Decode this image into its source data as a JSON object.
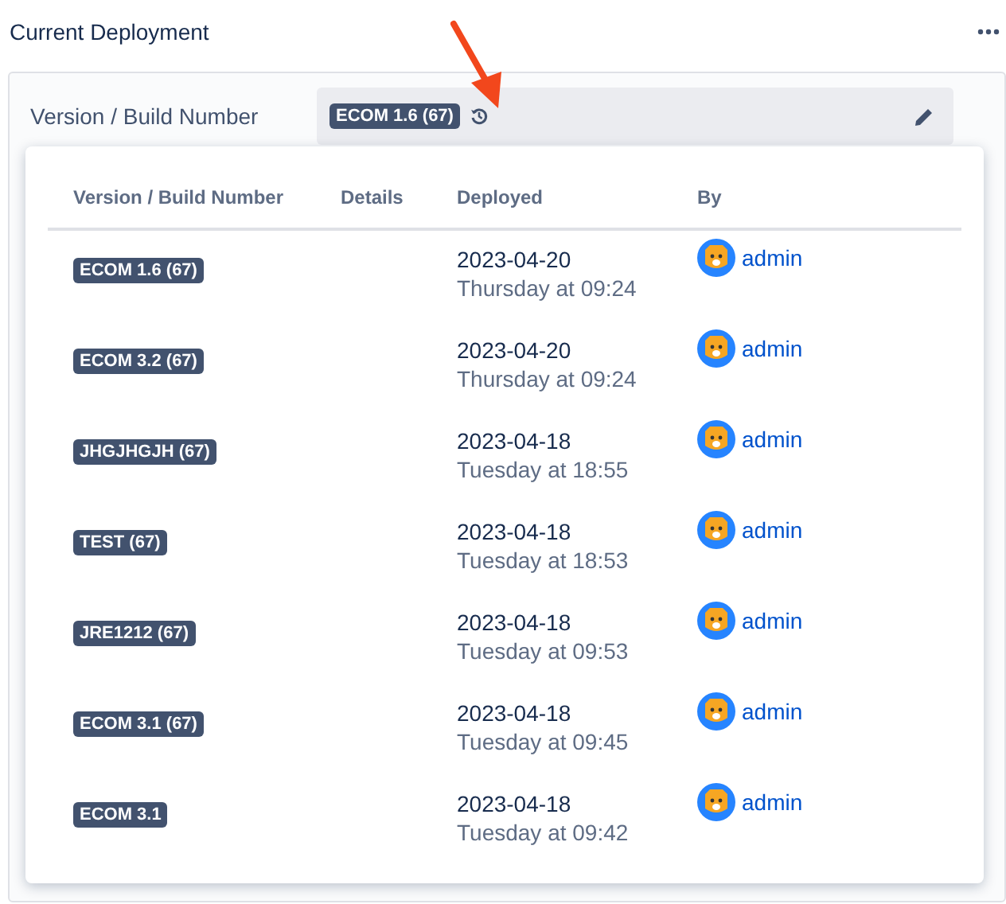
{
  "header": {
    "title": "Current Deployment"
  },
  "field": {
    "label": "Version / Build Number",
    "value": "ECOM 1.6 (67)"
  },
  "history": {
    "columns": [
      "Version / Build Number",
      "Details",
      "Deployed",
      "By"
    ],
    "rows": [
      {
        "version": "ECOM 1.6 (67)",
        "date": "2023-04-20",
        "time": "Thursday at 09:24",
        "by": "admin"
      },
      {
        "version": "ECOM 3.2 (67)",
        "date": "2023-04-20",
        "time": "Thursday at 09:24",
        "by": "admin"
      },
      {
        "version": "JHGJHGJH (67)",
        "date": "2023-04-18",
        "time": "Tuesday at 18:55",
        "by": "admin"
      },
      {
        "version": "TEST (67)",
        "date": "2023-04-18",
        "time": "Tuesday at 18:53",
        "by": "admin"
      },
      {
        "version": "JRE1212 (67)",
        "date": "2023-04-18",
        "time": "Tuesday at 09:53",
        "by": "admin"
      },
      {
        "version": "ECOM 3.1 (67)",
        "date": "2023-04-18",
        "time": "Tuesday at 09:45",
        "by": "admin"
      },
      {
        "version": "ECOM 3.1",
        "date": "2023-04-18",
        "time": "Tuesday at 09:42",
        "by": "admin"
      }
    ]
  }
}
